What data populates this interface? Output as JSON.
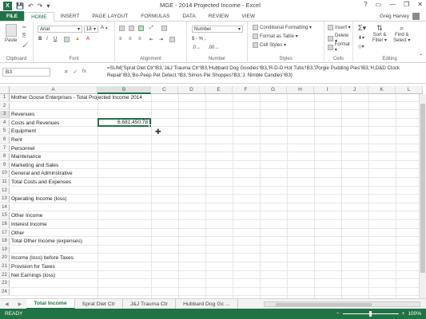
{
  "window": {
    "title": "MGE - 2014 Projected Income - Excel",
    "user": "Greg Harvey",
    "controls": [
      "?",
      "▭",
      "—",
      "❐",
      "✕"
    ]
  },
  "ribbon_tabs": [
    "FILE",
    "HOME",
    "INSERT",
    "PAGE LAYOUT",
    "FORMULAS",
    "DATA",
    "REVIEW",
    "VIEW"
  ],
  "ribbon": {
    "clipboard": {
      "label": "Clipboard",
      "paste": "Paste"
    },
    "font": {
      "label": "Font",
      "family": "Arial",
      "size": "18"
    },
    "alignment": {
      "label": "Alignment"
    },
    "number": {
      "label": "Number",
      "format": "Number",
      "symbols": "$ - % ,"
    },
    "styles": {
      "label": "Styles",
      "items": [
        "Conditional Formatting ▾",
        "Format as Table ▾",
        "Cell Styles ▾"
      ]
    },
    "cells": {
      "label": "Cells",
      "items": [
        "Insert ▾",
        "Delete ▾",
        "Format ▾"
      ]
    },
    "editing": {
      "label": "Editing",
      "sort": "Sort &",
      "filter": "Filter ▾",
      "find": "Find &",
      "select": "Select ▾"
    }
  },
  "formula_bar": {
    "name_box": "B3",
    "formula": "=SUM('Sprat Diet Ctr'!B3,'J&J Trauma Ctr'!B3,'Hubbard Dog Goodies'!B3,'R-D-D Hot Tubs'!B3,'Porgie Pudding Pies'!B3,'H,D&D Clock Repair'!B3,'Bo-Peep Pet Detect.'!B3,'Simon Pie Shoppes'!B3,'J. Nimble Candles'!B3)"
  },
  "columns": [
    "A",
    "B",
    "C",
    "D",
    "E",
    "F",
    "G",
    "H",
    "I",
    "J",
    "K",
    "L"
  ],
  "rows": [
    {
      "n": "1",
      "a": "Mother Goose Enterprises - Total Projected Income 2014"
    },
    {
      "n": "2",
      "a": ""
    },
    {
      "n": "3",
      "a": "Revenues"
    },
    {
      "n": "4",
      "a": "Costs and Revenues"
    },
    {
      "n": "5",
      "a": "   Equipment"
    },
    {
      "n": "6",
      "a": "   Rent"
    },
    {
      "n": "7",
      "a": "   Personnel"
    },
    {
      "n": "8",
      "a": "   Maintenance"
    },
    {
      "n": "9",
      "a": "   Marketing and Sales"
    },
    {
      "n": "10",
      "a": "   General and Adminstrative"
    },
    {
      "n": "11",
      "a": "Total Costs and Expenses"
    },
    {
      "n": "12",
      "a": ""
    },
    {
      "n": "13",
      "a": "Operating Income (loss)"
    },
    {
      "n": "14",
      "a": ""
    },
    {
      "n": "15",
      "a": "Other Income"
    },
    {
      "n": "16",
      "a": "Interest Income"
    },
    {
      "n": "17",
      "a": "Other"
    },
    {
      "n": "18",
      "a": "Total Other Income (expenses)"
    },
    {
      "n": "19",
      "a": ""
    },
    {
      "n": "20",
      "a": "Income (loss) before Taxes"
    },
    {
      "n": "21",
      "a": "Provision for Taxes"
    },
    {
      "n": "22",
      "a": "Net Earnings (loss)"
    },
    {
      "n": "23",
      "a": ""
    },
    {
      "n": "24",
      "a": ""
    }
  ],
  "active_cell": {
    "ref": "B3",
    "value": "6,681,450.78"
  },
  "sheet_tabs": [
    "Total Income",
    "Sprat Diet Ctr",
    "J&J Trauma Ctr",
    "Hubbard Dog Gc ..."
  ],
  "status": {
    "mode": "READY",
    "zoom": "100%"
  }
}
